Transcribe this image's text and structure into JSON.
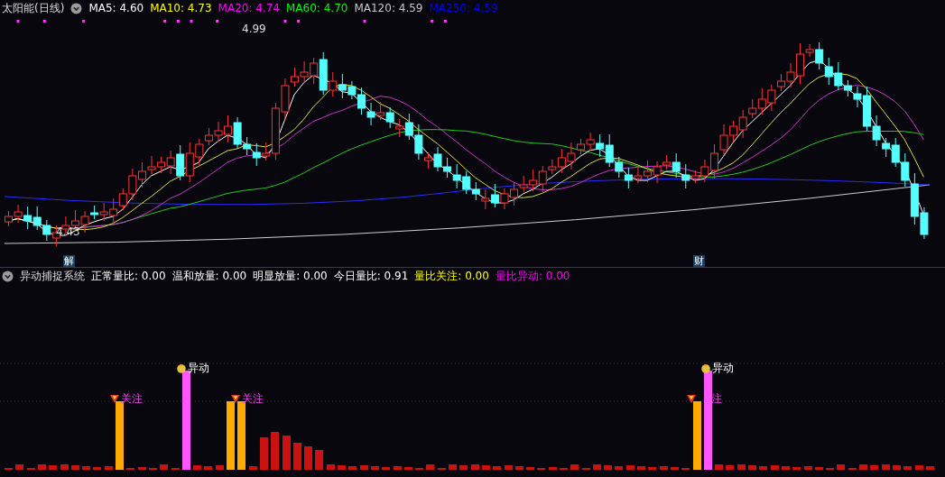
{
  "main_panel": {
    "title": "太阳能(日线)",
    "indicators": [
      {
        "label": "MA5: 4.60",
        "color": "#ffffff"
      },
      {
        "label": "MA10: 4.73",
        "color": "#ffff00"
      },
      {
        "label": "MA20: 4.74",
        "color": "#ff00ff"
      },
      {
        "label": "MA60: 4.70",
        "color": "#00ff00"
      },
      {
        "label": "MA120: 4.59",
        "color": "#c8c8c8"
      },
      {
        "label": "MA250: 4.59",
        "color": "#0000ff"
      }
    ],
    "price_labels": [
      {
        "kind": "high",
        "text": "4.99"
      },
      {
        "kind": "low",
        "text": "4.43"
      }
    ],
    "event_markers": [
      "解",
      "财"
    ]
  },
  "volume_panel": {
    "title": "异动捕捉系统",
    "indicators": [
      {
        "label": "正常量比: 0.00",
        "color": "#ffffff"
      },
      {
        "label": "温和放量: 0.00",
        "color": "#ffffff"
      },
      {
        "label": "明显放量: 0.00",
        "color": "#ffffff"
      },
      {
        "label": "今日量比: 0.91",
        "color": "#ffffff"
      },
      {
        "label": "量比关注: 0.00",
        "color": "#ffff00"
      },
      {
        "label": "量比异动: 0.00",
        "color": "#ff00ff"
      }
    ],
    "signals": [
      {
        "kind": "watch",
        "label": "关注"
      },
      {
        "kind": "anomaly",
        "label": "异动"
      },
      {
        "kind": "watch",
        "label": "关注"
      },
      {
        "kind": "anomaly",
        "label": "异动"
      },
      {
        "kind": "watch",
        "label": "注"
      }
    ]
  }
}
